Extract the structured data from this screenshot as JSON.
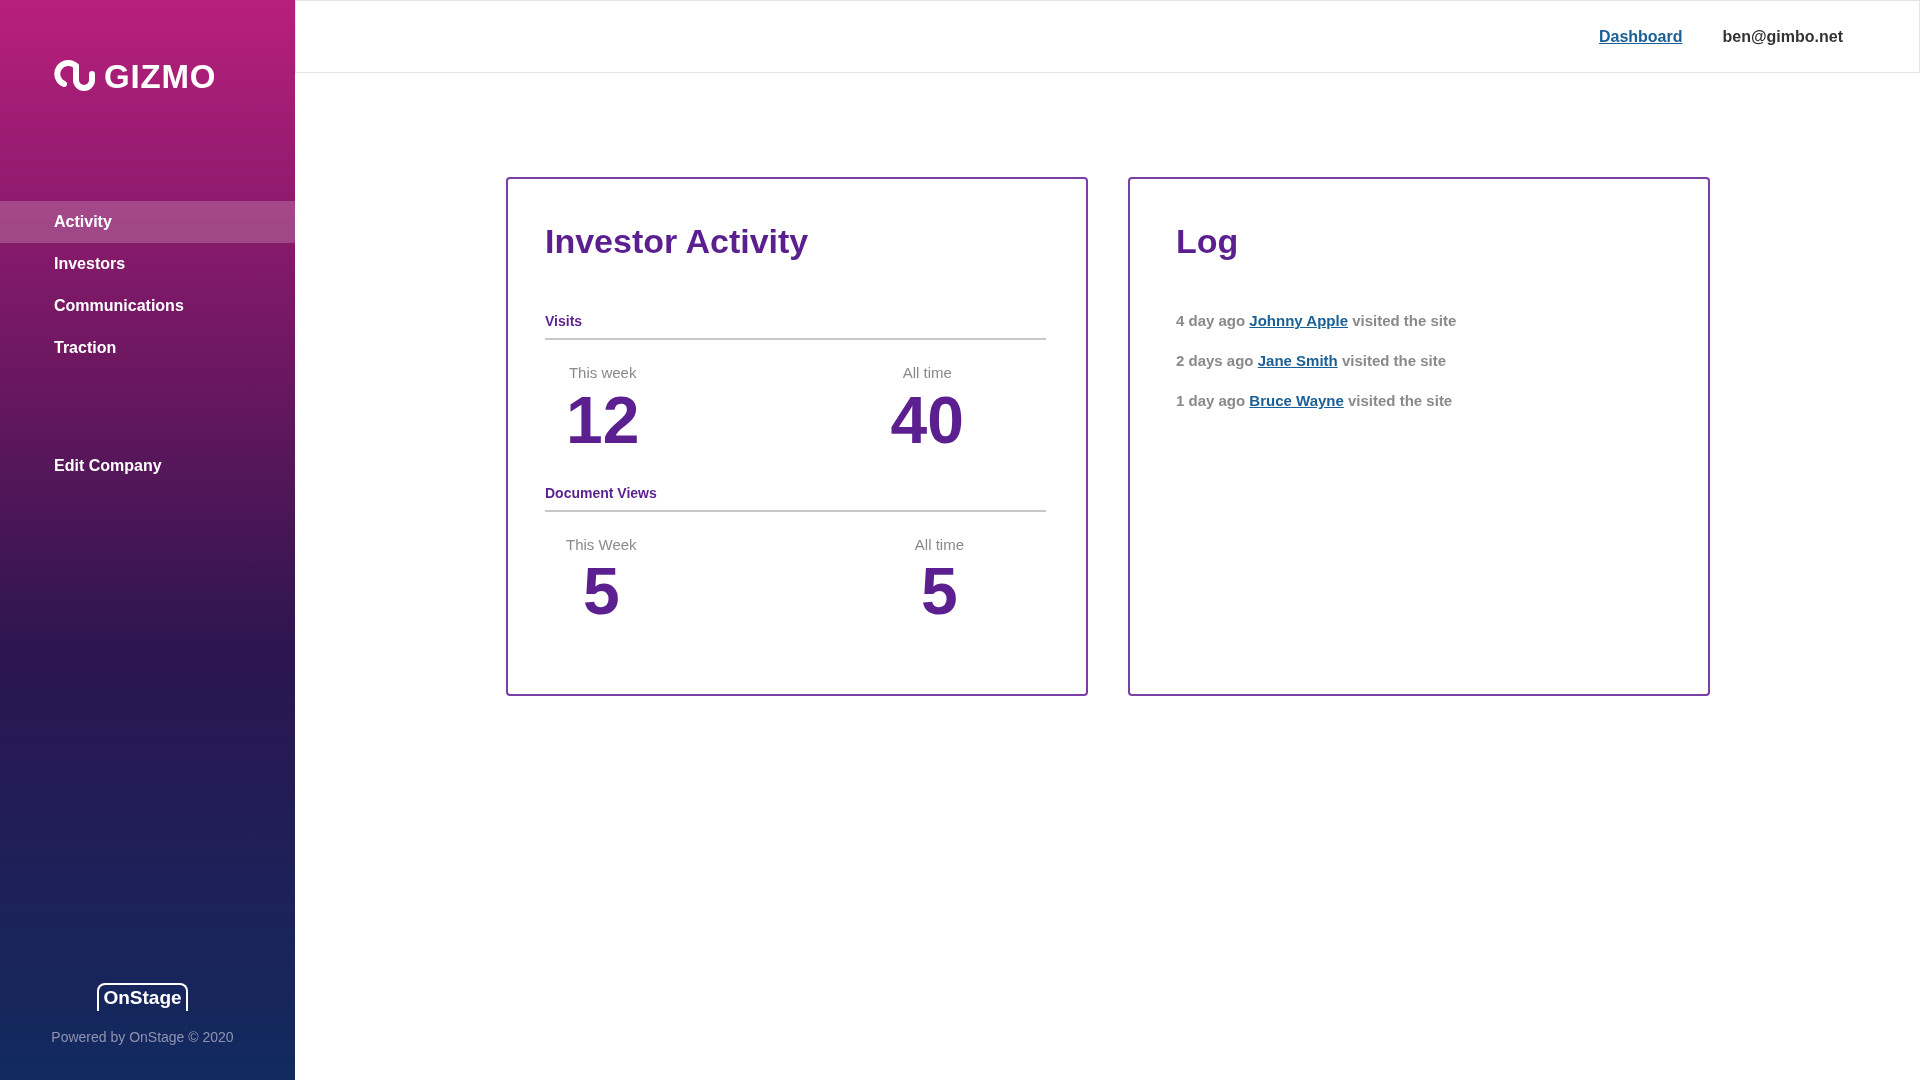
{
  "sidebar": {
    "logo": "GIZMO",
    "items": [
      {
        "label": "Activity",
        "selected": true
      },
      {
        "label": "Investors",
        "selected": false
      },
      {
        "label": "Communications",
        "selected": false
      },
      {
        "label": "Traction",
        "selected": false
      }
    ],
    "secondary_items": [
      {
        "label": "Edit Company",
        "selected": false
      }
    ],
    "footer": {
      "logo": "OnStage",
      "text": "Powered by OnStage © 2020"
    }
  },
  "header": {
    "link": "Dashboard",
    "user": "ben@gimbo.net"
  },
  "investor_activity": {
    "title": "Investor Activity",
    "sections": [
      {
        "label": "Visits",
        "stats": [
          {
            "label": "This week",
            "value": "12"
          },
          {
            "label": "All time",
            "value": "40"
          }
        ]
      },
      {
        "label": "Document Views",
        "stats": [
          {
            "label": "This Week",
            "value": "5"
          },
          {
            "label": "All time",
            "value": "5"
          }
        ]
      }
    ]
  },
  "log": {
    "title": "Log",
    "entries": [
      {
        "time": "4 day ago",
        "name": "Johnny Apple",
        "action": "visited the site"
      },
      {
        "time": "2 days ago",
        "name": "Jane Smith",
        "action": "visited the site"
      },
      {
        "time": "1 day ago",
        "name": "Bruce Wayne",
        "action": "visited the site"
      }
    ]
  }
}
